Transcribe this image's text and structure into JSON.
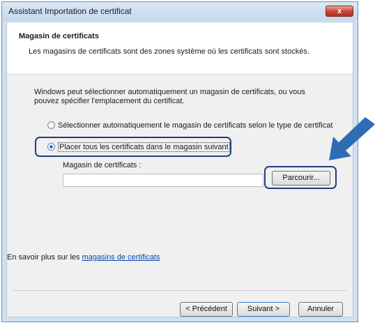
{
  "window": {
    "title": "Assistant Importation de certificat",
    "close_glyph": "x"
  },
  "header": {
    "title": "Magasin de certificats",
    "description": "Les magasins de certificats sont des zones système où les certificats sont stockés."
  },
  "intro": "Windows peut sélectionner automatiquement un magasin de certificats, ou vous pouvez spécifier l'emplacement du certificat.",
  "options": {
    "auto": {
      "label": "Sélectionner automatiquement le magasin de certificats selon le type de certificat",
      "checked": false
    },
    "manual": {
      "label": "Placer tous les certificats dans le magasin suivant",
      "checked": true
    }
  },
  "store": {
    "label": "Magasin de certificats :",
    "value": ""
  },
  "browse_label": "Parcourir...",
  "learn_more": {
    "prefix": "En savoir plus sur les ",
    "link": "magasins de certificats"
  },
  "footer": {
    "prev": "< Précédent",
    "next": "Suivant >",
    "cancel": "Annuler"
  },
  "colors": {
    "highlight": "#1e3f7a",
    "arrow": "#2e6db4",
    "link": "#0645ad"
  }
}
